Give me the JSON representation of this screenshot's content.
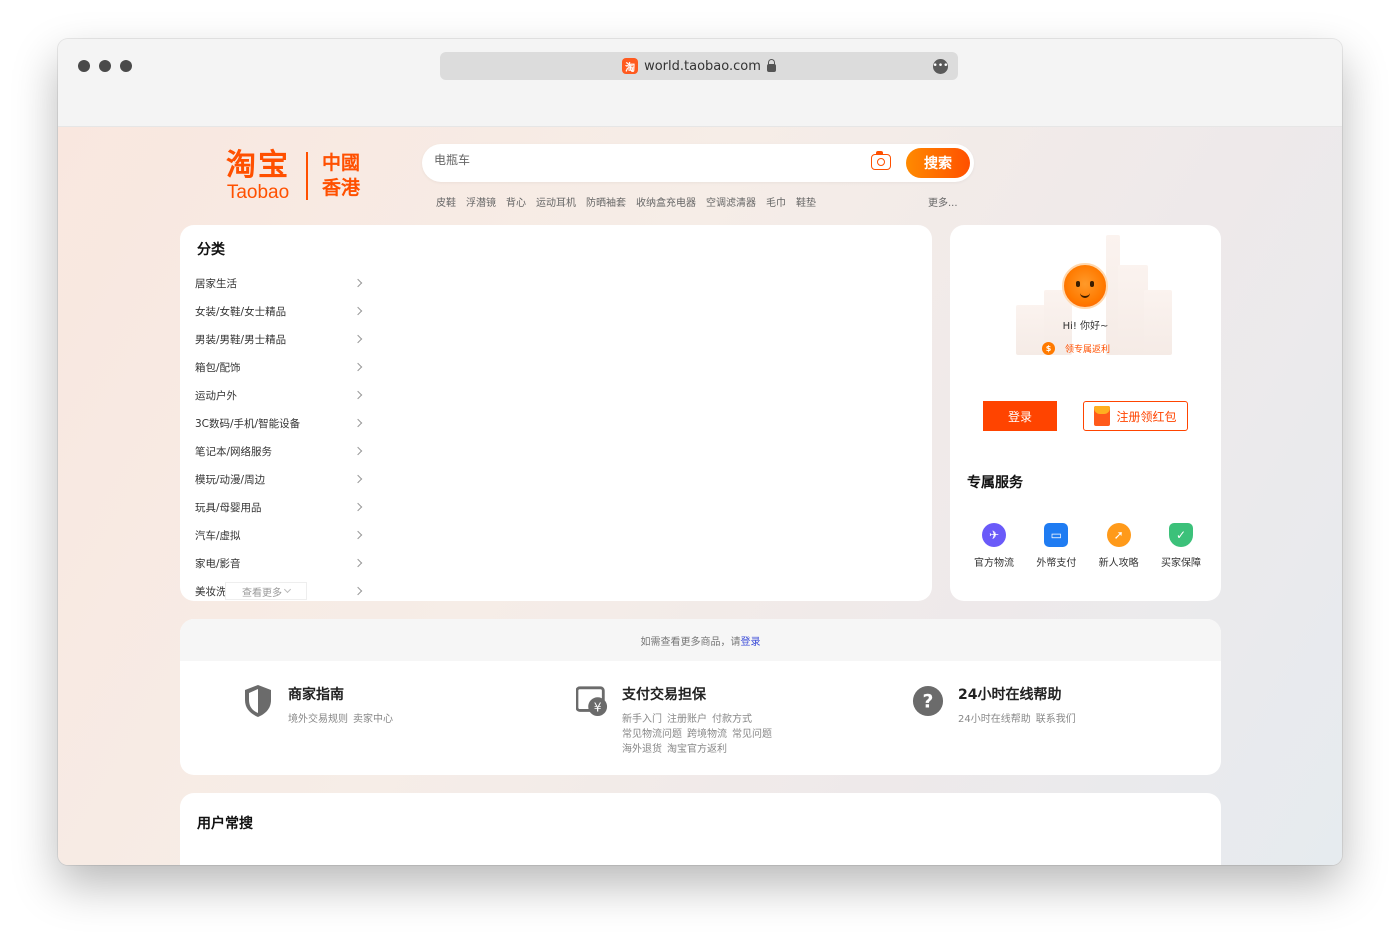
{
  "browser": {
    "url": "world.taobao.com",
    "favicon_glyph": "淘"
  },
  "header": {
    "logo_cn": "淘宝",
    "logo_en": "Taobao",
    "region_line1": "中國",
    "region_line2": "香港",
    "search": {
      "placeholder": "电瓶车",
      "button_label": "搜索"
    },
    "hotwords": [
      "皮鞋",
      "浮潜镜",
      "背心",
      "运动耳机",
      "防晒袖套",
      "收纳盒充电器",
      "空调滤清器",
      "毛巾",
      "鞋垫"
    ],
    "hotwords_more": "更多..."
  },
  "categories": {
    "title": "分类",
    "items": [
      "居家生活",
      "女装/女鞋/女士精品",
      "男装/男鞋/男士精品",
      "箱包/配饰",
      "运动户外",
      "3C数码/手机/智能设备",
      "笔记本/网络服务",
      "模玩/动漫/周边",
      "玩具/母婴用品",
      "汽车/虚拟",
      "家电/影音",
      "美妆洗护"
    ],
    "see_more": "查看更多"
  },
  "user_panel": {
    "greeting": "Hi! 你好~",
    "coin_glyph": "$",
    "rebate_text": "领专属返利",
    "login_label": "登录",
    "register_label": "注册领红包",
    "services_title": "专属服务",
    "services": [
      {
        "label": "官方物流",
        "icon": "logistics-icon",
        "color": "#6a5af9"
      },
      {
        "label": "外幣支付",
        "icon": "wallet-icon",
        "color": "#1f7cf2"
      },
      {
        "label": "新人攻略",
        "icon": "compass-icon",
        "color": "#ff9a1a"
      },
      {
        "label": "买家保障",
        "icon": "shield-check-icon",
        "color": "#3cc17a"
      }
    ]
  },
  "login_prompt": {
    "text": "如需查看更多商品，请",
    "link": "登录"
  },
  "info_sections": [
    {
      "title": "商家指南",
      "icon": "shield-icon",
      "lines": [
        [
          "境外交易规则",
          "卖家中心"
        ]
      ]
    },
    {
      "title": "支付交易担保",
      "icon": "payment-guarantee-icon",
      "lines": [
        [
          "新手入门",
          "注册账户",
          "付款方式"
        ],
        [
          "常见物流问题",
          "跨境物流",
          "常见问题"
        ],
        [
          "海外退货",
          "淘宝官方返利"
        ]
      ]
    },
    {
      "title": "24小时在线帮助",
      "icon": "help-icon",
      "lines": [
        [
          "24小时在线帮助",
          "联系我们"
        ]
      ]
    }
  ],
  "popular": {
    "title": "用户常搜"
  },
  "colors": {
    "brand": "#ff5000",
    "login": "#ff4400",
    "link": "#3a4bd8"
  }
}
